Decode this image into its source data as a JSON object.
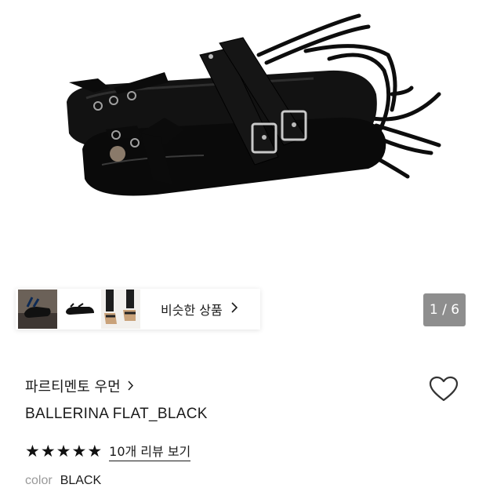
{
  "gallery": {
    "pager": "1 / 6",
    "similar_label": "비슷한 상품",
    "thumbnails": [
      "product-thumb-1",
      "product-thumb-2",
      "product-thumb-3"
    ]
  },
  "product": {
    "brand": "파르티멘토 우먼",
    "brand_chevron": "›",
    "title": "BALLERINA FLAT_BLACK",
    "rating": 5,
    "review_link": "10개 리뷰 보기",
    "option_label": "color",
    "option_value": "BLACK"
  },
  "icons": {
    "heart": "heart-outline-icon",
    "chevron": "chevron-right-icon",
    "star": "star-filled-icon"
  },
  "colors": {
    "pager_bg": "#8e8e8e",
    "text": "#1a1a1a",
    "muted": "#999999"
  }
}
